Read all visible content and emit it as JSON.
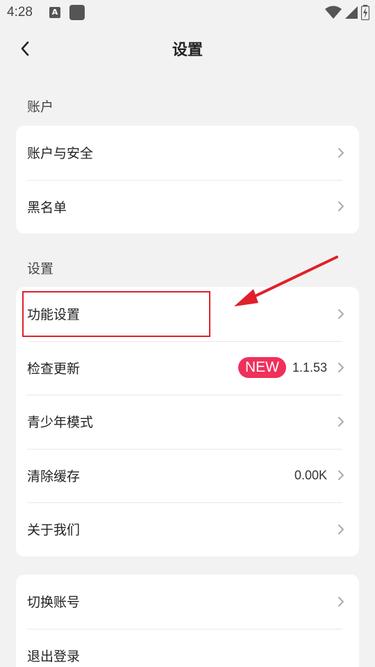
{
  "status_bar": {
    "time": "4:28",
    "notif_icon_letter": "A",
    "icons": [
      "wifi-icon",
      "signal-icon",
      "battery-icon"
    ]
  },
  "header": {
    "title": "设置",
    "back_icon": "chevron-left-icon"
  },
  "sections": {
    "account_label": "账户",
    "settings_label": "设置"
  },
  "account_card": {
    "items": [
      {
        "label": "账户与安全"
      },
      {
        "label": "黑名单"
      }
    ]
  },
  "settings_card": {
    "items": [
      {
        "label": "功能设置"
      },
      {
        "label": "检查更新",
        "badge": "NEW",
        "value": "1.1.53"
      },
      {
        "label": "青少年模式"
      },
      {
        "label": "清除缓存",
        "value": "0.00K"
      },
      {
        "label": "关于我们"
      }
    ]
  },
  "session_card": {
    "items": [
      {
        "label": "切换账号"
      },
      {
        "label": "退出登录"
      }
    ]
  },
  "annotation": {
    "color": "#e0202a",
    "highlight_target": "功能设置"
  },
  "colors": {
    "background": "#f2f2f2",
    "card": "#ffffff",
    "badge": "#f0305a"
  }
}
